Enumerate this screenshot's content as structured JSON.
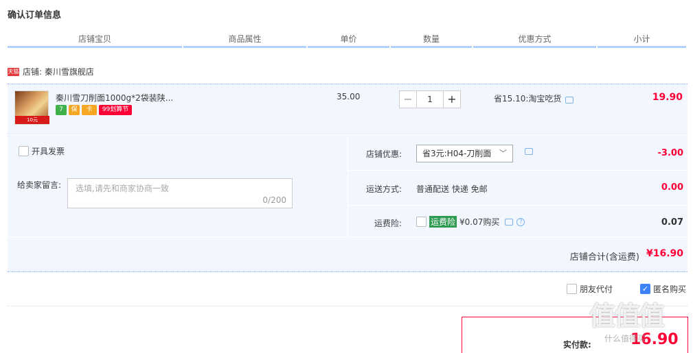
{
  "title": "确认订单信息",
  "columns": [
    "店铺宝贝",
    "商品属性",
    "单价",
    "数量",
    "优惠方式",
    "小计"
  ],
  "shop": {
    "badge": "天猫",
    "label": "店铺: 秦川雪旗舰店"
  },
  "item": {
    "image_sticker": "10元",
    "title": "秦川雪刀削面1000g*2袋装陕...",
    "icons": [
      "7",
      "保",
      "卡",
      "99划算节"
    ],
    "price": "35.00",
    "qty": "1",
    "qty_minus": "−",
    "qty_plus": "+",
    "discount": "省15.10:淘宝吃货",
    "subtotal": "19.90"
  },
  "invoice": {
    "label": "开具发票"
  },
  "memo": {
    "label": "给卖家留言:",
    "placeholder": "选填,请先和商家协商一致",
    "count": "0/200"
  },
  "store_discount": {
    "label": "店铺优惠:",
    "selected": "省3元:H04-刀削面",
    "amount": "-3.00"
  },
  "shipping": {
    "label": "运送方式:",
    "value": "普通配送 快递 免邮",
    "amount": "0.00"
  },
  "insurance": {
    "label": "运费险:",
    "tag": "运费险",
    "value": "¥0.07购买",
    "amount": "0.07"
  },
  "store_total": {
    "label": "店铺合计(含运费)",
    "amount": "¥16.90"
  },
  "friend_pay": {
    "label": "朋友代付"
  },
  "anonymous": {
    "label": "匿名购买"
  },
  "pay": {
    "label": "实付款:",
    "amount": "16.90"
  },
  "watermark": {
    "text": "值值值",
    "url": "什么值得买"
  }
}
